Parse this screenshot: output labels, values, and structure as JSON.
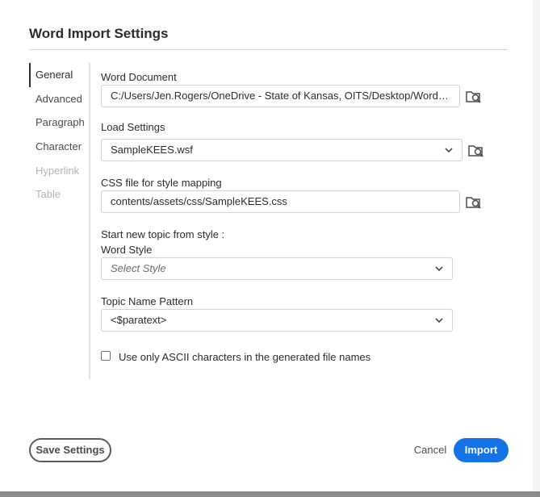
{
  "dialog": {
    "title": "Word Import Settings"
  },
  "nav": {
    "items": [
      {
        "label": "General",
        "state": "active"
      },
      {
        "label": "Advanced",
        "state": "normal"
      },
      {
        "label": "Paragraph",
        "state": "normal"
      },
      {
        "label": "Character",
        "state": "normal"
      },
      {
        "label": "Hyperlink",
        "state": "disabled"
      },
      {
        "label": "Table",
        "state": "disabled"
      }
    ]
  },
  "form": {
    "word_document": {
      "label": "Word Document",
      "value": "C:/Users/Jen.Rogers/OneDrive - State of Kansas, OITS/Desktop/Word to RH St...",
      "browse_icon": "folder-search-icon"
    },
    "load_settings": {
      "label": "Load Settings",
      "value": "SampleKEES.wsf",
      "browse_icon": "folder-search-icon"
    },
    "css_file": {
      "label": "CSS file for style mapping",
      "value": "contents/assets/css/SampleKEES.css",
      "browse_icon": "folder-search-icon"
    },
    "new_topic_heading": "Start new topic from style :",
    "word_style": {
      "label": "Word Style",
      "placeholder": "Select Style"
    },
    "topic_name_pattern": {
      "label": "Topic Name Pattern",
      "value": "<$paratext>"
    },
    "ascii_checkbox": {
      "label": "Use only ASCII characters in the generated file names",
      "checked": false
    }
  },
  "footer": {
    "save_label": "Save Settings",
    "cancel_label": "Cancel",
    "import_label": "Import"
  },
  "colors": {
    "accent": "#1473e6",
    "text": "#2c2c2c",
    "border": "#d3d3d3",
    "disabled": "#b3b3b3"
  }
}
